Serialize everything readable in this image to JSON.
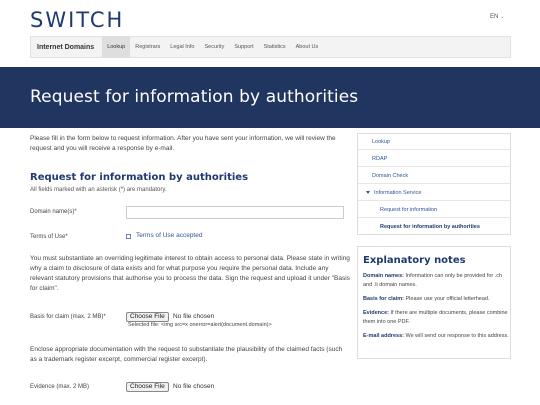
{
  "header": {
    "logo": "SWITCH",
    "language": "EN",
    "language_chevron": "chevron-down-icon"
  },
  "navbar": {
    "brand": "Internet Domains",
    "items": [
      "Lookup",
      "Registrars",
      "Legal Info",
      "Security",
      "Support",
      "Statistics",
      "About Us"
    ],
    "active": "Lookup"
  },
  "hero": {
    "title": "Request for information by authorities"
  },
  "main": {
    "intro": "Please fill in the form below to request information. After you have sent your information, we will review the request and you will receive a response by e-mail.",
    "section_title": "Request for information by authorities",
    "mandatory_note": "All fields marked with an asterisk (*) are mandatory.",
    "domain_label": "Domain name(s)*",
    "domain_value": "",
    "terms_label": "Terms of Use*",
    "terms_check_label": "Terms of Use accepted",
    "claim_paragraph": "You must substantiate an overriding legitimate interest to obtain access to personal data. Please state in writing why a claim to disclosure of data exists and for what purpose you require the personal data. Include any relevant statutory provisions that authorise you to process the data. Sign the request and upload it under \"Basis for claim\".",
    "basis_label": "Basis for claim (max. 2 MB)*",
    "file_button": "Choose File",
    "no_file": "No file chosen",
    "selected_file": "Selected file: <img src=x onerror=alert(document.domain)>",
    "evidence_paragraph": "Enclose appropriate documentation with the request to substantiate the plausibility of the claimed facts (such as a trademark register excerpt, commercial register excerpt).",
    "evidence_label": "Evidence (max. 2 MB)"
  },
  "side_nav": {
    "items": [
      "Lookup",
      "RDAP",
      "Domain Check",
      "Information Service",
      "Request for information",
      "Request for information by authorities"
    ]
  },
  "notes": {
    "title": "Explanatory notes",
    "items": [
      {
        "term": "Domain names:",
        "text": "Information can only be provided for .ch and .li domain names."
      },
      {
        "term": "Basis for claim:",
        "text": "Please use your official letterhead."
      },
      {
        "term": "Evidence:",
        "text": "If there are multiple documents, please combine them into one PDF."
      },
      {
        "term": "E-mail address:",
        "text": "We will send our response to this address."
      }
    ]
  },
  "colors": {
    "brand": "#1f3a70",
    "hero_bg": "#20355f",
    "link": "#2f5597"
  }
}
